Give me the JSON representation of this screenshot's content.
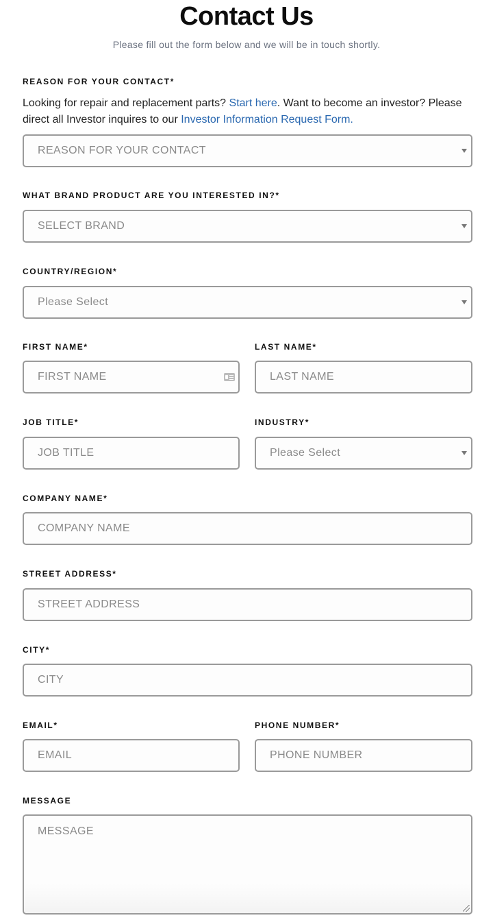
{
  "header": {
    "title": "Contact Us",
    "subtitle": "Please fill out the form below and we will be in touch shortly."
  },
  "reason": {
    "label": "REASON FOR YOUR CONTACT*",
    "intro_text_1": "Looking for repair and replacement parts? ",
    "intro_link_1": "Start here",
    "intro_text_2": ". Want to become an investor? Please direct all Investor inquires to our ",
    "intro_link_2": "Investor Information Request Form.",
    "placeholder": "REASON FOR YOUR CONTACT"
  },
  "brand": {
    "label": "WHAT BRAND PRODUCT ARE YOU INTERESTED IN?*",
    "placeholder": "SELECT BRAND"
  },
  "country": {
    "label": "COUNTRY/REGION*",
    "placeholder": "Please Select"
  },
  "first_name": {
    "label": "FIRST NAME*",
    "placeholder": "FIRST NAME",
    "icon": "contact-card-icon"
  },
  "last_name": {
    "label": "LAST NAME*",
    "placeholder": "LAST NAME"
  },
  "job_title": {
    "label": "JOB TITLE*",
    "placeholder": "JOB TITLE"
  },
  "industry": {
    "label": "INDUSTRY*",
    "placeholder": "Please Select"
  },
  "company": {
    "label": "COMPANY NAME*",
    "placeholder": "COMPANY NAME"
  },
  "street": {
    "label": "STREET ADDRESS*",
    "placeholder": "STREET ADDRESS"
  },
  "city": {
    "label": "CITY*",
    "placeholder": "CITY"
  },
  "email": {
    "label": "EMAIL*",
    "placeholder": "EMAIL"
  },
  "phone": {
    "label": "PHONE NUMBER*",
    "placeholder": "PHONE NUMBER"
  },
  "message": {
    "label": "MESSAGE",
    "placeholder": "MESSAGE"
  },
  "colors": {
    "link": "#2a68b0",
    "border": "#9a9a9a",
    "placeholder": "#8a8a8a"
  }
}
